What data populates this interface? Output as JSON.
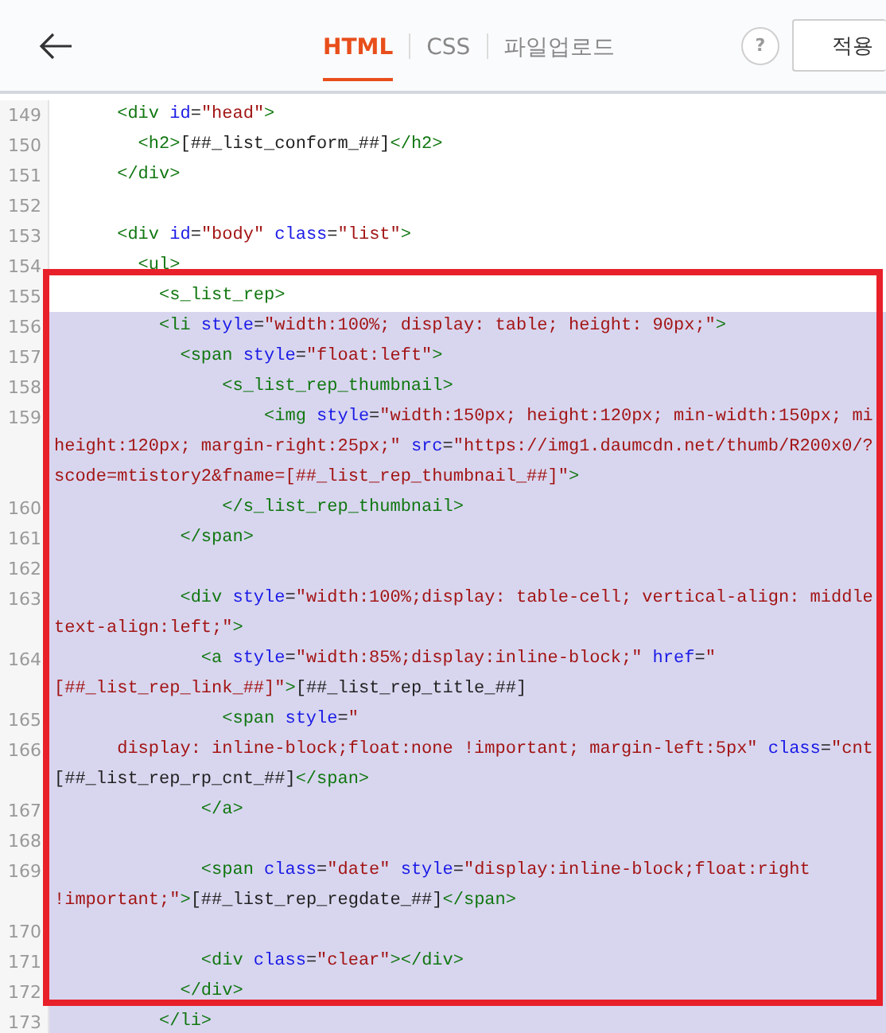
{
  "tabs": [
    {
      "label": "HTML",
      "selected": true
    },
    {
      "label": "CSS",
      "selected": false
    },
    {
      "label": "파일업로드",
      "selected": false
    }
  ],
  "help_button": "?",
  "apply_button": "적용",
  "lines": [
    {
      "number": "149",
      "selected": false,
      "rows": [
        {
          "tokens": [
            {
              "kind": "tag",
              "text": "      <div"
            },
            {
              "kind": "attr",
              "text": " id"
            },
            {
              "kind": "plain",
              "text": "="
            },
            {
              "kind": "string",
              "text": "\"head\""
            },
            {
              "kind": "tag",
              "text": ">"
            }
          ]
        }
      ]
    },
    {
      "number": "150",
      "selected": false,
      "rows": [
        {
          "tokens": [
            {
              "kind": "tag",
              "text": "        <h2>"
            },
            {
              "kind": "plain",
              "text": "[##_list_conform_##]"
            },
            {
              "kind": "tag",
              "text": "</h2>"
            }
          ]
        }
      ]
    },
    {
      "number": "151",
      "selected": false,
      "rows": [
        {
          "tokens": [
            {
              "kind": "tag",
              "text": "      </div>"
            }
          ]
        }
      ]
    },
    {
      "number": "152",
      "selected": false
    },
    {
      "number": "153",
      "selected": false,
      "rows": [
        {
          "tokens": [
            {
              "kind": "tag",
              "text": "      <div"
            },
            {
              "kind": "attr",
              "text": " id"
            },
            {
              "kind": "plain",
              "text": "="
            },
            {
              "kind": "string",
              "text": "\"body\""
            },
            {
              "kind": "attr",
              "text": " class"
            },
            {
              "kind": "plain",
              "text": "="
            },
            {
              "kind": "string",
              "text": "\"list\""
            },
            {
              "kind": "tag",
              "text": ">"
            }
          ]
        }
      ]
    },
    {
      "number": "154",
      "selected": false,
      "rows": [
        {
          "tokens": [
            {
              "kind": "tag",
              "text": "        <ul>"
            }
          ]
        }
      ]
    },
    {
      "number": "155",
      "selected": false,
      "rows": [
        {
          "tokens": [
            {
              "kind": "tag",
              "text": "          <s_list_rep>"
            }
          ]
        }
      ]
    },
    {
      "number": "156",
      "selected": true,
      "rows": [
        {
          "tokens": [
            {
              "kind": "tag",
              "text": "          <li"
            },
            {
              "kind": "attr",
              "text": " style"
            },
            {
              "kind": "plain",
              "text": "="
            },
            {
              "kind": "string",
              "text": "\"width:100%; display: table; height: 90px;\""
            },
            {
              "kind": "tag",
              "text": ">"
            }
          ]
        }
      ]
    },
    {
      "number": "157",
      "selected": true,
      "rows": [
        {
          "tokens": [
            {
              "kind": "tag",
              "text": "            <span"
            },
            {
              "kind": "attr",
              "text": " style"
            },
            {
              "kind": "plain",
              "text": "="
            },
            {
              "kind": "string",
              "text": "\"float:left\""
            },
            {
              "kind": "tag",
              "text": ">"
            }
          ]
        }
      ]
    },
    {
      "number": "158",
      "selected": true,
      "rows": [
        {
          "tokens": [
            {
              "kind": "tag",
              "text": "                <s_list_rep_thumbnail>"
            }
          ]
        }
      ]
    },
    {
      "number": "159",
      "selected": true,
      "rows": [
        {
          "tokens": [
            {
              "kind": "tag",
              "text": "                    <img"
            },
            {
              "kind": "attr",
              "text": " style"
            },
            {
              "kind": "plain",
              "text": "="
            },
            {
              "kind": "string",
              "text": "\"width:150px; height:120px; min-width:150px; mi"
            }
          ]
        },
        {
          "tokens": [
            {
              "kind": "string",
              "text": "height:120px; margin-right:25px;\""
            },
            {
              "kind": "attr",
              "text": " src"
            },
            {
              "kind": "plain",
              "text": "="
            },
            {
              "kind": "string",
              "text": "\"https://img1.daumcdn.net/thumb/R200x0/?"
            }
          ]
        },
        {
          "tokens": [
            {
              "kind": "string",
              "text": "scode=mtistory2&fname=[##_list_rep_thumbnail_##]\""
            },
            {
              "kind": "tag",
              "text": ">"
            }
          ]
        }
      ]
    },
    {
      "number": "160",
      "selected": true,
      "rows": [
        {
          "tokens": [
            {
              "kind": "tag",
              "text": "                </s_list_rep_thumbnail>"
            }
          ]
        }
      ]
    },
    {
      "number": "161",
      "selected": true,
      "rows": [
        {
          "tokens": [
            {
              "kind": "tag",
              "text": "            </span>"
            }
          ]
        }
      ]
    },
    {
      "number": "162",
      "selected": true
    },
    {
      "number": "163",
      "selected": true,
      "rows": [
        {
          "tokens": [
            {
              "kind": "tag",
              "text": "            <div"
            },
            {
              "kind": "attr",
              "text": " style"
            },
            {
              "kind": "plain",
              "text": "="
            },
            {
              "kind": "string",
              "text": "\"width:100%;display: table-cell; vertical-align: middle"
            }
          ]
        },
        {
          "tokens": [
            {
              "kind": "string",
              "text": "text-align:left;\""
            },
            {
              "kind": "tag",
              "text": ">"
            }
          ]
        }
      ]
    },
    {
      "number": "164",
      "selected": true,
      "rows": [
        {
          "tokens": [
            {
              "kind": "tag",
              "text": "              <a"
            },
            {
              "kind": "attr",
              "text": " style"
            },
            {
              "kind": "plain",
              "text": "="
            },
            {
              "kind": "string",
              "text": "\"width:85%;display:inline-block;\""
            },
            {
              "kind": "attr",
              "text": " href"
            },
            {
              "kind": "plain",
              "text": "="
            },
            {
              "kind": "string",
              "text": "\""
            }
          ]
        },
        {
          "tokens": [
            {
              "kind": "string",
              "text": "[##_list_rep_link_##]\""
            },
            {
              "kind": "tag",
              "text": ">"
            },
            {
              "kind": "plain",
              "text": "[##_list_rep_title_##]"
            }
          ]
        }
      ]
    },
    {
      "number": "165",
      "selected": true,
      "rows": [
        {
          "tokens": [
            {
              "kind": "tag",
              "text": "                <span"
            },
            {
              "kind": "attr",
              "text": " style"
            },
            {
              "kind": "plain",
              "text": "="
            },
            {
              "kind": "string",
              "text": "\""
            }
          ]
        }
      ]
    },
    {
      "number": "166",
      "selected": true,
      "rows": [
        {
          "tokens": [
            {
              "kind": "string",
              "text": "      display: inline-block;float:none !important; margin-left:5px\""
            },
            {
              "kind": "attr",
              "text": " class"
            },
            {
              "kind": "plain",
              "text": "="
            },
            {
              "kind": "string",
              "text": "\"cnt"
            }
          ]
        },
        {
          "tokens": [
            {
              "kind": "plain",
              "text": "[##_list_rep_rp_cnt_##]"
            },
            {
              "kind": "tag",
              "text": "</span>"
            }
          ]
        }
      ]
    },
    {
      "number": "167",
      "selected": true,
      "rows": [
        {
          "tokens": [
            {
              "kind": "tag",
              "text": "              </a>"
            }
          ]
        }
      ]
    },
    {
      "number": "168",
      "selected": true
    },
    {
      "number": "169",
      "selected": true,
      "rows": [
        {
          "tokens": [
            {
              "kind": "tag",
              "text": "              <span"
            },
            {
              "kind": "attr",
              "text": " class"
            },
            {
              "kind": "plain",
              "text": "="
            },
            {
              "kind": "string",
              "text": "\"date\""
            },
            {
              "kind": "attr",
              "text": " style"
            },
            {
              "kind": "plain",
              "text": "="
            },
            {
              "kind": "string",
              "text": "\"display:inline-block;float:right"
            }
          ]
        },
        {
          "tokens": [
            {
              "kind": "string",
              "text": "!important;\""
            },
            {
              "kind": "tag",
              "text": ">"
            },
            {
              "kind": "plain",
              "text": "[##_list_rep_regdate_##]"
            },
            {
              "kind": "tag",
              "text": "</span>"
            }
          ]
        }
      ]
    },
    {
      "number": "170",
      "selected": true
    },
    {
      "number": "171",
      "selected": true,
      "rows": [
        {
          "tokens": [
            {
              "kind": "tag",
              "text": "              <div"
            },
            {
              "kind": "attr",
              "text": " class"
            },
            {
              "kind": "plain",
              "text": "="
            },
            {
              "kind": "string",
              "text": "\"clear\""
            },
            {
              "kind": "tag",
              "text": "></div>"
            }
          ]
        }
      ]
    },
    {
      "number": "172",
      "selected": true,
      "rows": [
        {
          "tokens": [
            {
              "kind": "tag",
              "text": "            </div>"
            }
          ]
        }
      ]
    },
    {
      "number": "173",
      "selected": true,
      "rows": [
        {
          "tokens": [
            {
              "kind": "tag",
              "text": "          </li>"
            }
          ]
        }
      ]
    }
  ]
}
